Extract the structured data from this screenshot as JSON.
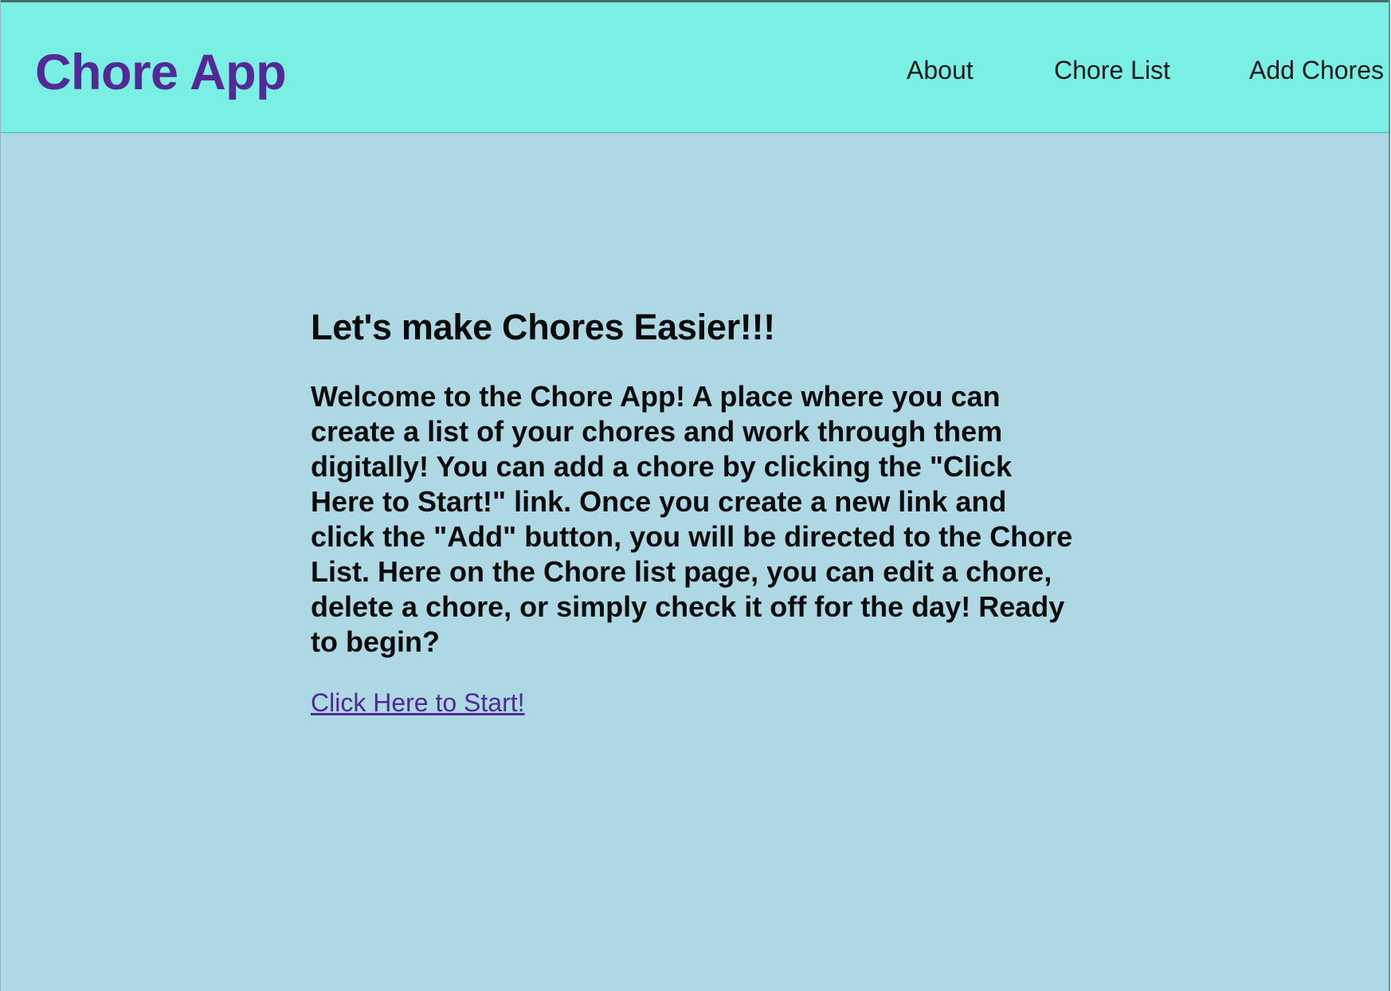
{
  "header": {
    "brand": "Chore App",
    "nav": {
      "about": "About",
      "chore_list": "Chore List",
      "add_chores": "Add Chores"
    }
  },
  "main": {
    "headline": "Let's make Chores Easier!!!",
    "intro": "Welcome to the Chore App! A place where you can create a list of your chores and work through them digitally! You can add a chore by clicking the \"Click Here to Start!\" link. Once you create a new link and click the \"Add\" button, you will be directed to the Chore List. Here on the Chore list page, you can edit a chore, delete a chore, or simply check it off for the day! Ready to begin?",
    "start_link": "Click Here to Start!"
  },
  "colors": {
    "navbar_bg": "#7aefe4",
    "page_bg": "#aed8e4",
    "brand": "#532a95",
    "link": "#4e2a94",
    "text": "#0b0b0b"
  }
}
